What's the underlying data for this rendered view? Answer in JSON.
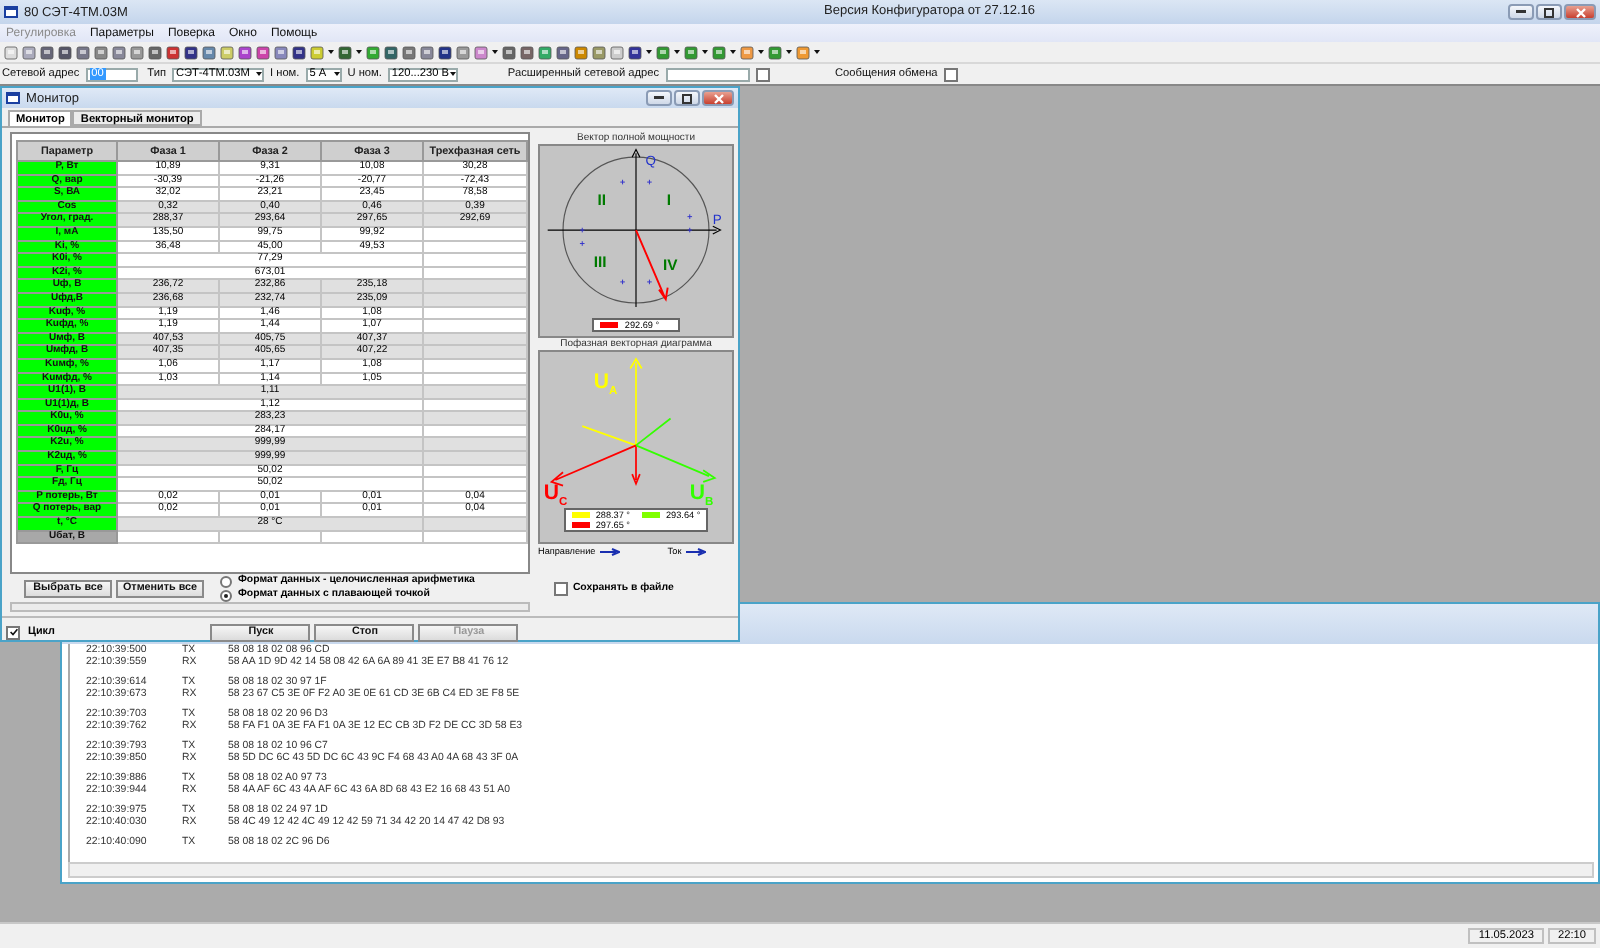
{
  "app_window": {
    "title": "80  СЭТ-4ТМ.03М",
    "version": "Версия Конфигуратора  от 27.12.16"
  },
  "menu": [
    {
      "label": "Регулировка",
      "disabled": true
    },
    {
      "label": "Параметры",
      "disabled": false
    },
    {
      "label": "Поверка",
      "disabled": false
    },
    {
      "label": "Окно",
      "disabled": false
    },
    {
      "label": "Помощь",
      "disabled": false
    }
  ],
  "address_bar": {
    "net_address_label": "Сетевой адрес",
    "net_address": "00",
    "type_label": "Тип",
    "type": "СЭТ-4ТМ.03М",
    "i_nom_label": "I ном.",
    "i_nom": "5 А",
    "u_nom_label": "U ном.",
    "u_nom": "120...230 В",
    "ext_address_label": "Расширенный сетевой адрес",
    "ext_address_checked": false,
    "messages_label": "Сообщения обмена",
    "messages_checked": false
  },
  "monitor": {
    "title": "Монитор",
    "tabs": [
      {
        "label": "Монитор",
        "selected": true
      },
      {
        "label": "Векторный монитор",
        "selected": false
      }
    ],
    "table": {
      "columns": [
        "Параметр",
        "Фаза 1",
        "Фаза 2",
        "Фаза 3",
        "Трехфазная сеть"
      ],
      "rows": [
        {
          "param": "P, Вт",
          "enabled": true,
          "shaded": false,
          "kind": "phases",
          "values": [
            "10,89",
            "9,31",
            "10,08",
            "30,28"
          ]
        },
        {
          "param": "Q, вар",
          "enabled": true,
          "shaded": false,
          "kind": "phases",
          "values": [
            "-30,39",
            "-21,26",
            "-20,77",
            "-72,43"
          ]
        },
        {
          "param": "S, ВА",
          "enabled": true,
          "shaded": false,
          "kind": "phases",
          "values": [
            "32,02",
            "23,21",
            "23,45",
            "78,58"
          ]
        },
        {
          "param": "Cos",
          "enabled": true,
          "shaded": true,
          "kind": "phases",
          "values": [
            "0,32",
            "0,40",
            "0,46",
            "0,39"
          ]
        },
        {
          "param": "Угол, град.",
          "enabled": true,
          "shaded": true,
          "kind": "phases",
          "values": [
            "288,37",
            "293,64",
            "297,65",
            "292,69"
          ]
        },
        {
          "param": "I, мА",
          "enabled": true,
          "shaded": false,
          "kind": "phases",
          "values": [
            "135,50",
            "99,75",
            "99,92"
          ]
        },
        {
          "param": "Ki, %",
          "enabled": true,
          "shaded": false,
          "kind": "phases",
          "values": [
            "36,48",
            "45,00",
            "49,53"
          ]
        },
        {
          "param": "K0i, %",
          "enabled": true,
          "shaded": false,
          "kind": "merged",
          "values": [
            "77,29"
          ]
        },
        {
          "param": "K2i, %",
          "enabled": true,
          "shaded": false,
          "kind": "merged",
          "values": [
            "673,01"
          ]
        },
        {
          "param": "Uф, В",
          "enabled": true,
          "shaded": true,
          "kind": "phases",
          "values": [
            "236,72",
            "232,86",
            "235,18"
          ]
        },
        {
          "param": "Uфд,В",
          "enabled": true,
          "shaded": true,
          "kind": "phases",
          "values": [
            "236,68",
            "232,74",
            "235,09"
          ]
        },
        {
          "param": "Kuф, %",
          "enabled": true,
          "shaded": false,
          "kind": "phases",
          "values": [
            "1,19",
            "1,46",
            "1,08"
          ]
        },
        {
          "param": "Kuфд, %",
          "enabled": true,
          "shaded": false,
          "kind": "phases",
          "values": [
            "1,19",
            "1,44",
            "1,07"
          ]
        },
        {
          "param": "Uмф, В",
          "enabled": true,
          "shaded": true,
          "kind": "phases",
          "values": [
            "407,53",
            "405,75",
            "407,37"
          ]
        },
        {
          "param": "Uмфд, В",
          "enabled": true,
          "shaded": true,
          "kind": "phases",
          "values": [
            "407,35",
            "405,65",
            "407,22"
          ]
        },
        {
          "param": "Kuмф, %",
          "enabled": true,
          "shaded": false,
          "kind": "phases",
          "values": [
            "1,06",
            "1,17",
            "1,08"
          ]
        },
        {
          "param": "Kuмфд, %",
          "enabled": true,
          "shaded": false,
          "kind": "phases",
          "values": [
            "1,03",
            "1,14",
            "1,05"
          ]
        },
        {
          "param": "U1(1), В",
          "enabled": true,
          "shaded": true,
          "kind": "merged",
          "values": [
            "1,11"
          ]
        },
        {
          "param": "U1(1)д, В",
          "enabled": true,
          "shaded": false,
          "kind": "merged",
          "values": [
            "1,12"
          ]
        },
        {
          "param": "K0u, %",
          "enabled": true,
          "shaded": true,
          "kind": "merged",
          "values": [
            "283,23"
          ]
        },
        {
          "param": "K0uд, %",
          "enabled": true,
          "shaded": false,
          "kind": "merged",
          "values": [
            "284,17"
          ]
        },
        {
          "param": "K2u, %",
          "enabled": true,
          "shaded": true,
          "kind": "merged",
          "values": [
            "999,99"
          ]
        },
        {
          "param": "K2uд, %",
          "enabled": true,
          "shaded": true,
          "kind": "merged",
          "values": [
            "999,99"
          ]
        },
        {
          "param": "F, Гц",
          "enabled": true,
          "shaded": false,
          "kind": "merged",
          "values": [
            "50,02"
          ]
        },
        {
          "param": "Fд, Гц",
          "enabled": true,
          "shaded": false,
          "kind": "merged",
          "values": [
            "50,02"
          ]
        },
        {
          "param": "P потерь, Вт",
          "enabled": true,
          "shaded": false,
          "kind": "phases",
          "values": [
            "0,02",
            "0,01",
            "0,01",
            "0,04"
          ]
        },
        {
          "param": "Q потерь, вар",
          "enabled": true,
          "shaded": false,
          "kind": "phases",
          "values": [
            "0,02",
            "0,01",
            "0,01",
            "0,04"
          ]
        },
        {
          "param": "t, °C",
          "enabled": true,
          "shaded": true,
          "kind": "merged",
          "values": [
            "28 °C"
          ]
        },
        {
          "param": "Uбат, В",
          "enabled": false,
          "shaded": false,
          "kind": "phases",
          "values": []
        }
      ]
    },
    "select_all": "Выбрать все",
    "deselect_all": "Отменить все",
    "formats": [
      {
        "label": "Формат данных - целочисленная арифметика",
        "selected": false
      },
      {
        "label": "Формат данных с плавающей точкой",
        "selected": true
      }
    ],
    "power_vector": {
      "title": "Вектор полной мощности",
      "axis_q": "Q",
      "axis_p": "P",
      "quadrants": [
        "II",
        "I",
        "III",
        "IV"
      ],
      "legend": [
        {
          "label": "292.69 °",
          "color": "#ff0000"
        }
      ]
    },
    "phase_diagram": {
      "title": "Пофазная векторная диаграмма",
      "vectors": [
        {
          "symbol": "U",
          "phase": "A",
          "color": "#ffff00"
        },
        {
          "symbol": "U",
          "phase": "C",
          "color": "#ff0000"
        },
        {
          "symbol": "U",
          "phase": "B",
          "color": "#33ff00"
        }
      ],
      "legend": [
        {
          "label": "288.37 °",
          "color": "#ffff00"
        },
        {
          "label": "293.64 °",
          "color": "#80ff00"
        },
        {
          "label": "297.65 °",
          "color": "#ff0000"
        }
      ],
      "direction_label": "Направление",
      "current_label": "Ток"
    },
    "save_to_file": {
      "label": "Сохранять в файле",
      "checked": false
    },
    "cycle": {
      "label": "Цикл",
      "checked": true
    },
    "buttons": [
      {
        "label": "Пуск",
        "disabled": false
      },
      {
        "label": "Стоп",
        "disabled": false
      },
      {
        "label": "Пауза",
        "disabled": true
      }
    ]
  },
  "log": {
    "groups": [
      [
        {
          "time": "22:10:39:500",
          "dir": "TX",
          "data": "58 08 18 02 08 96 CD"
        },
        {
          "time": "22:10:39:559",
          "dir": "RX",
          "data": "58 AA 1D 9D 42 14 58 08 42 6A 6A 89 41 3E E7 B8 41 76 12"
        }
      ],
      [
        {
          "time": "22:10:39:614",
          "dir": "TX",
          "data": "58 08 18 02 30 97 1F"
        },
        {
          "time": "22:10:39:673",
          "dir": "RX",
          "data": "58 23 67 C5 3E 0F F2 A0 3E 0E 61 CD 3E 6B C4 ED 3E F8 5E"
        }
      ],
      [
        {
          "time": "22:10:39:703",
          "dir": "TX",
          "data": "58 08 18 02 20 96 D3"
        },
        {
          "time": "22:10:39:762",
          "dir": "RX",
          "data": "58 FA F1 0A 3E FA F1 0A 3E 12 EC CB 3D F2 DE CC 3D 58 E3"
        }
      ],
      [
        {
          "time": "22:10:39:793",
          "dir": "TX",
          "data": "58 08 18 02 10 96 C7"
        },
        {
          "time": "22:10:39:850",
          "dir": "RX",
          "data": "58 5D DC 6C 43 5D DC 6C 43 9C F4 68 43 A0 4A 68 43 3F 0A"
        }
      ],
      [
        {
          "time": "22:10:39:886",
          "dir": "TX",
          "data": "58 08 18 02 A0 97 73"
        },
        {
          "time": "22:10:39:944",
          "dir": "RX",
          "data": "58 4A AF 6C 43 4A AF 6C 43 6A 8D 68 43 E2 16 68 43 51 A0"
        }
      ],
      [
        {
          "time": "22:10:39:975",
          "dir": "TX",
          "data": "58 08 18 02 24 97 1D"
        },
        {
          "time": "22:10:40:030",
          "dir": "RX",
          "data": "58 4C 49 12 42 4C 49 12 42 59 71 34 42 20 14 47 42 D8 93"
        }
      ],
      [
        {
          "time": "22:10:40:090",
          "dir": "TX",
          "data": "58 08 18 02 2C 96 D6"
        }
      ]
    ]
  },
  "status_bar": {
    "date": "11.05.2023",
    "time": "22:10"
  }
}
